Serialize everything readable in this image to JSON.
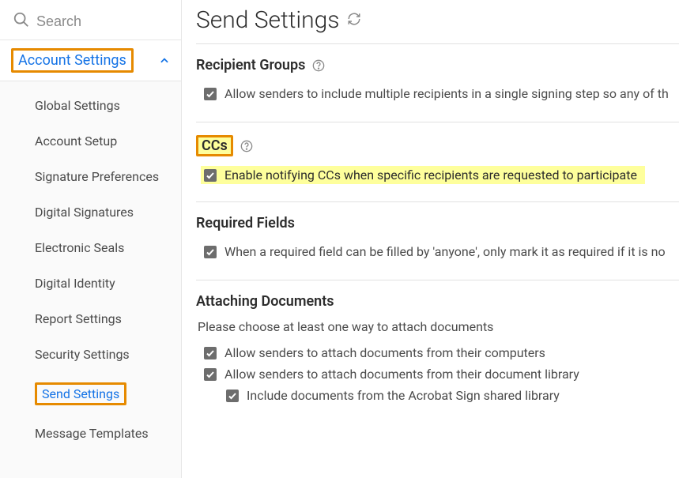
{
  "search": {
    "placeholder": "Search"
  },
  "sidebar": {
    "section_label": "Account Settings",
    "items": [
      {
        "label": "Global Settings"
      },
      {
        "label": "Account Setup"
      },
      {
        "label": "Signature Preferences"
      },
      {
        "label": "Digital Signatures"
      },
      {
        "label": "Electronic Seals"
      },
      {
        "label": "Digital Identity"
      },
      {
        "label": "Report Settings"
      },
      {
        "label": "Security Settings"
      },
      {
        "label": "Send Settings"
      },
      {
        "label": "Message Templates"
      }
    ]
  },
  "page_title": "Send Settings",
  "sections": {
    "recipient_groups": {
      "title": "Recipient Groups",
      "opt1": "Allow senders to include multiple recipients in a single signing step so any of th"
    },
    "ccs": {
      "title": "CCs",
      "opt1": "Enable notifying CCs when specific recipients are requested to participate"
    },
    "required_fields": {
      "title": "Required Fields",
      "opt1": "When a required field can be filled by 'anyone', only mark it as required if it is no"
    },
    "attaching": {
      "title": "Attaching Documents",
      "subtext": "Please choose at least one way to attach documents",
      "opt1": "Allow senders to attach documents from their computers",
      "opt2": "Allow senders to attach documents from their document library",
      "opt2a": "Include documents from the Acrobat Sign shared library"
    }
  }
}
